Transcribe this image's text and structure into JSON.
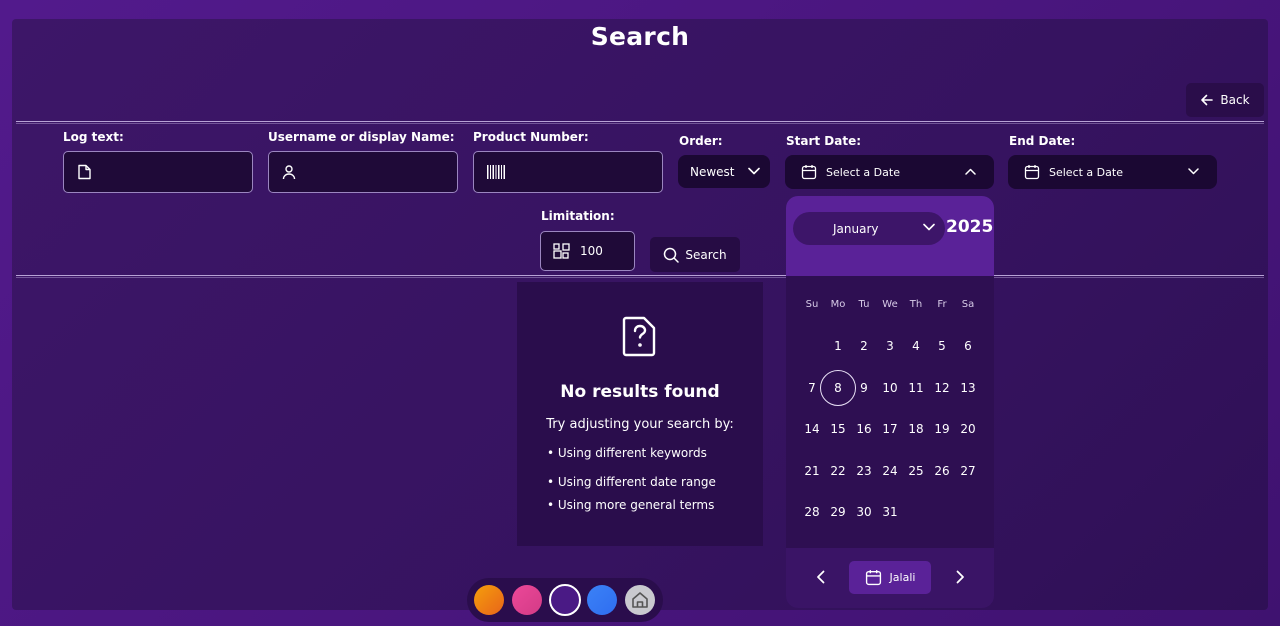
{
  "page": {
    "title": "Search",
    "back_label": "Back"
  },
  "filters": {
    "log_text": {
      "label": "Log text:",
      "value": ""
    },
    "username": {
      "label": "Username or display Name:",
      "value": ""
    },
    "product": {
      "label": "Product Number:",
      "value": ""
    },
    "order": {
      "label": "Order:",
      "value": "Newest"
    },
    "start_date": {
      "label": "Start Date:",
      "value": "Select a Date"
    },
    "end_date": {
      "label": "End Date:",
      "value": "Select a Date"
    },
    "limitation": {
      "label": "Limitation:",
      "value": "100"
    },
    "search_label": "Search"
  },
  "empty": {
    "title": "No results found",
    "subtitle": "Try adjusting your search by:",
    "tips": [
      "• Using different keywords",
      "• Using different date range",
      "• Using more general terms"
    ]
  },
  "calendar": {
    "month": "January",
    "year": "2025",
    "weekdays": [
      "Su",
      "Mo",
      "Tu",
      "We",
      "Th",
      "Fr",
      "Sa"
    ],
    "days": [
      "1",
      "2",
      "3",
      "4",
      "5",
      "6",
      "7",
      "8",
      "9",
      "10",
      "11",
      "12",
      "13",
      "14",
      "15",
      "16",
      "17",
      "18",
      "19",
      "20",
      "21",
      "22",
      "23",
      "24",
      "25",
      "26",
      "27",
      "28",
      "29",
      "30",
      "31"
    ],
    "selected_day": "8",
    "mode_label": "Jalali"
  },
  "theme_colors": [
    "#f59e0b",
    "#e8418f",
    "#4a1a85",
    "#3b82f6",
    "#c9c9cf"
  ]
}
